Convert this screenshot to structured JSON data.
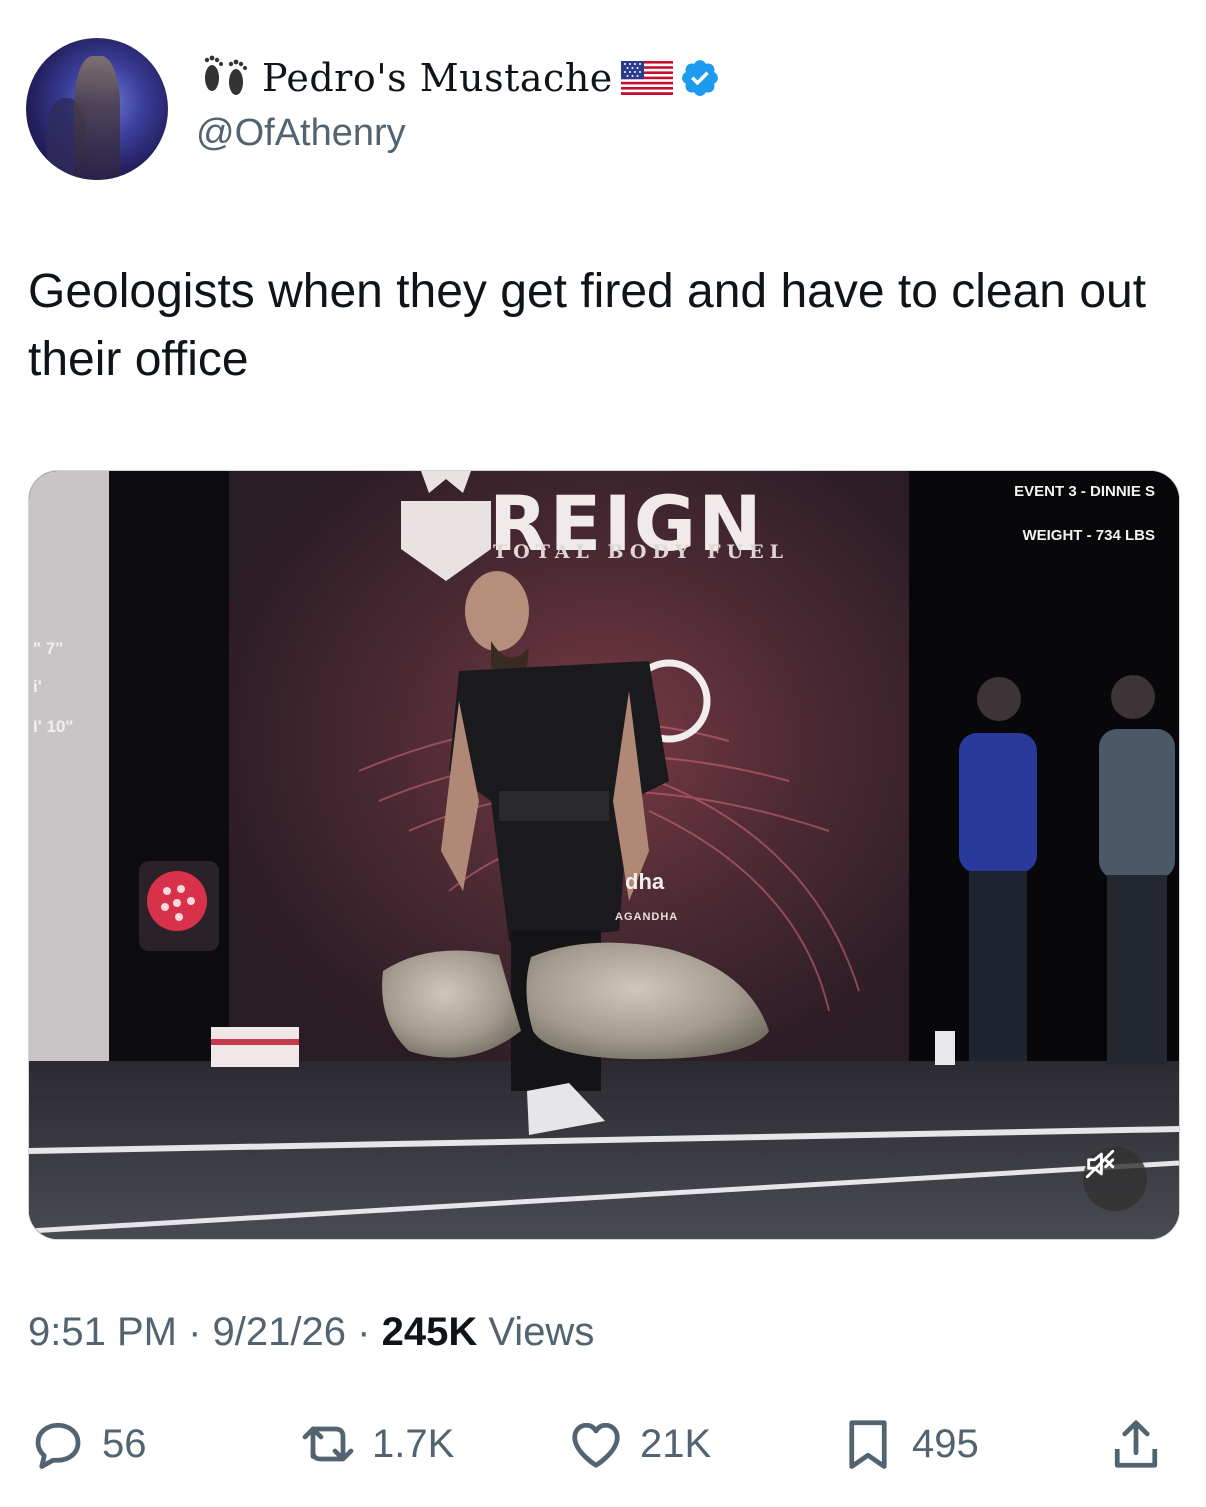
{
  "author": {
    "display_name": "Pedro's Mustache",
    "handle": "@OfAthenry",
    "avatar_icon": "user-avatar",
    "name_prefix_icon": "footprints-icon",
    "name_suffix_icon": "us-flag-icon",
    "verified_icon": "verified-badge-icon",
    "verified_color": "#1d9bf0"
  },
  "tweet": {
    "text": "Geologists when they get fired and have to clean out their office"
  },
  "media": {
    "type": "video",
    "overlay": {
      "brand": "REIGN",
      "brand_sub": "TOTAL BODY FUEL",
      "event": "EVENT 3 - DINNIE S",
      "weight": "WEIGHT - 734 LBS",
      "side_1": "\" 7\"",
      "side_2": "i'",
      "side_3": "I' 10\"",
      "sponsor": "dha",
      "sponsor_sub": "AGANDHA"
    },
    "mute_icon": "speaker-muted-icon"
  },
  "meta": {
    "time": "9:51 PM",
    "separator": "·",
    "date": "9/21/26",
    "views_count": "245K",
    "views_label": "Views"
  },
  "actions": {
    "replies": {
      "icon": "reply-icon",
      "count": "56"
    },
    "reposts": {
      "icon": "repost-icon",
      "count": "1.7K"
    },
    "likes": {
      "icon": "heart-icon",
      "count": "21K"
    },
    "bookmarks": {
      "icon": "bookmark-icon",
      "count": "495"
    },
    "share": {
      "icon": "share-icon"
    }
  },
  "colors": {
    "text_primary": "#0f1419",
    "text_secondary": "#536471"
  }
}
